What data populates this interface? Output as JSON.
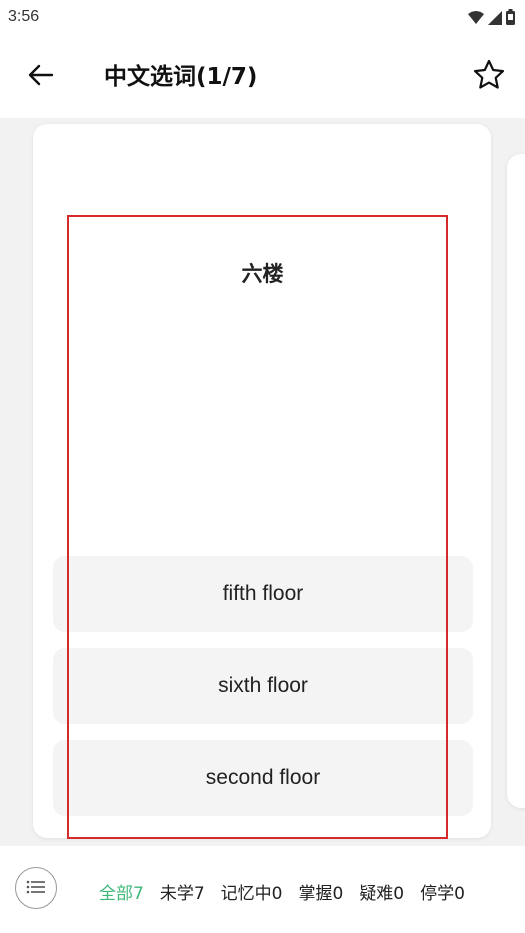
{
  "status_bar": {
    "time": "3:56",
    "icons": [
      "wifi-icon",
      "signal-icon",
      "battery-icon"
    ]
  },
  "header": {
    "back_icon": "arrow-left-icon",
    "title": "中文选词(1/7)",
    "favorite_icon": "star-outline-icon"
  },
  "card": {
    "word": "六楼",
    "options": [
      {
        "label": "fifth floor"
      },
      {
        "label": "sixth floor"
      },
      {
        "label": "second floor"
      }
    ]
  },
  "bottom_bar": {
    "menu_icon": "list-icon",
    "filters": [
      {
        "label": "全部7",
        "active": true
      },
      {
        "label": "未学7",
        "active": false
      },
      {
        "label": "记忆中0",
        "active": false
      },
      {
        "label": "掌握0",
        "active": false
      },
      {
        "label": "疑难0",
        "active": false
      },
      {
        "label": "停学0",
        "active": false
      }
    ]
  },
  "colors": {
    "accent": "#3fb87a",
    "highlight_border": "#d42a2a",
    "background": "#f2f2f2"
  }
}
